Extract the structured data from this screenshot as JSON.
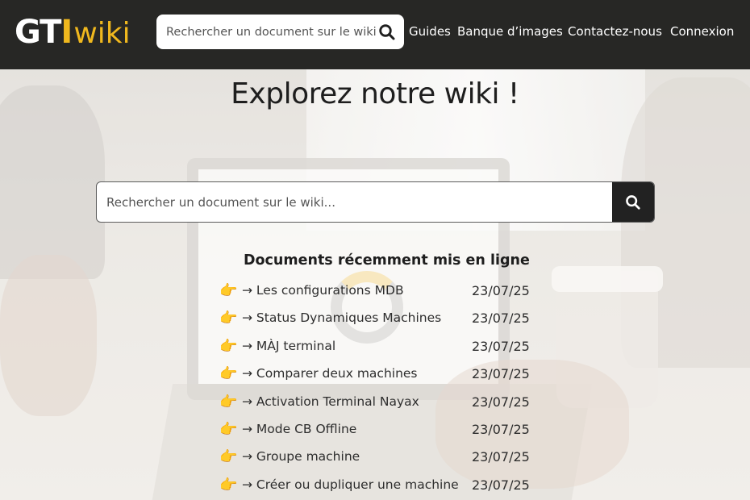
{
  "logo": {
    "gt": "GT",
    "i": "I",
    "wiki": "wiki"
  },
  "header_search": {
    "placeholder": "Rechercher un document sur le wiki..."
  },
  "nav": {
    "guides": "Guides",
    "images": "Banque d’images",
    "contact": "Contactez-nous",
    "login": "Connexion"
  },
  "hero": {
    "title": "Explorez notre wiki !",
    "search_placeholder": "Rechercher un document sur le wiki..."
  },
  "recent": {
    "title": "Documents récemment mis en ligne",
    "arrow": "→",
    "icon": "👉",
    "items": [
      {
        "label": "→ Les configurations MDB",
        "date": "23/07/25"
      },
      {
        "label": "→ Status Dynamiques Machines",
        "date": "23/07/25"
      },
      {
        "label": "→ MÀJ terminal",
        "date": "23/07/25"
      },
      {
        "label": "→ Comparer deux machines",
        "date": "23/07/25"
      },
      {
        "label": "→ Activation Terminal Nayax",
        "date": "23/07/25"
      },
      {
        "label": "→ Mode CB Offline",
        "date": "23/07/25"
      },
      {
        "label": "→ Groupe machine",
        "date": "23/07/25"
      },
      {
        "label": "→ Créer ou dupliquer une machine",
        "date": "23/07/25"
      }
    ]
  },
  "colors": {
    "header_bg": "#272725",
    "brand_yellow": "#f0b81e",
    "search_button_bg": "#222222"
  },
  "icons": {
    "search": "search-icon",
    "pointing_hand": "pointing-hand-icon"
  }
}
